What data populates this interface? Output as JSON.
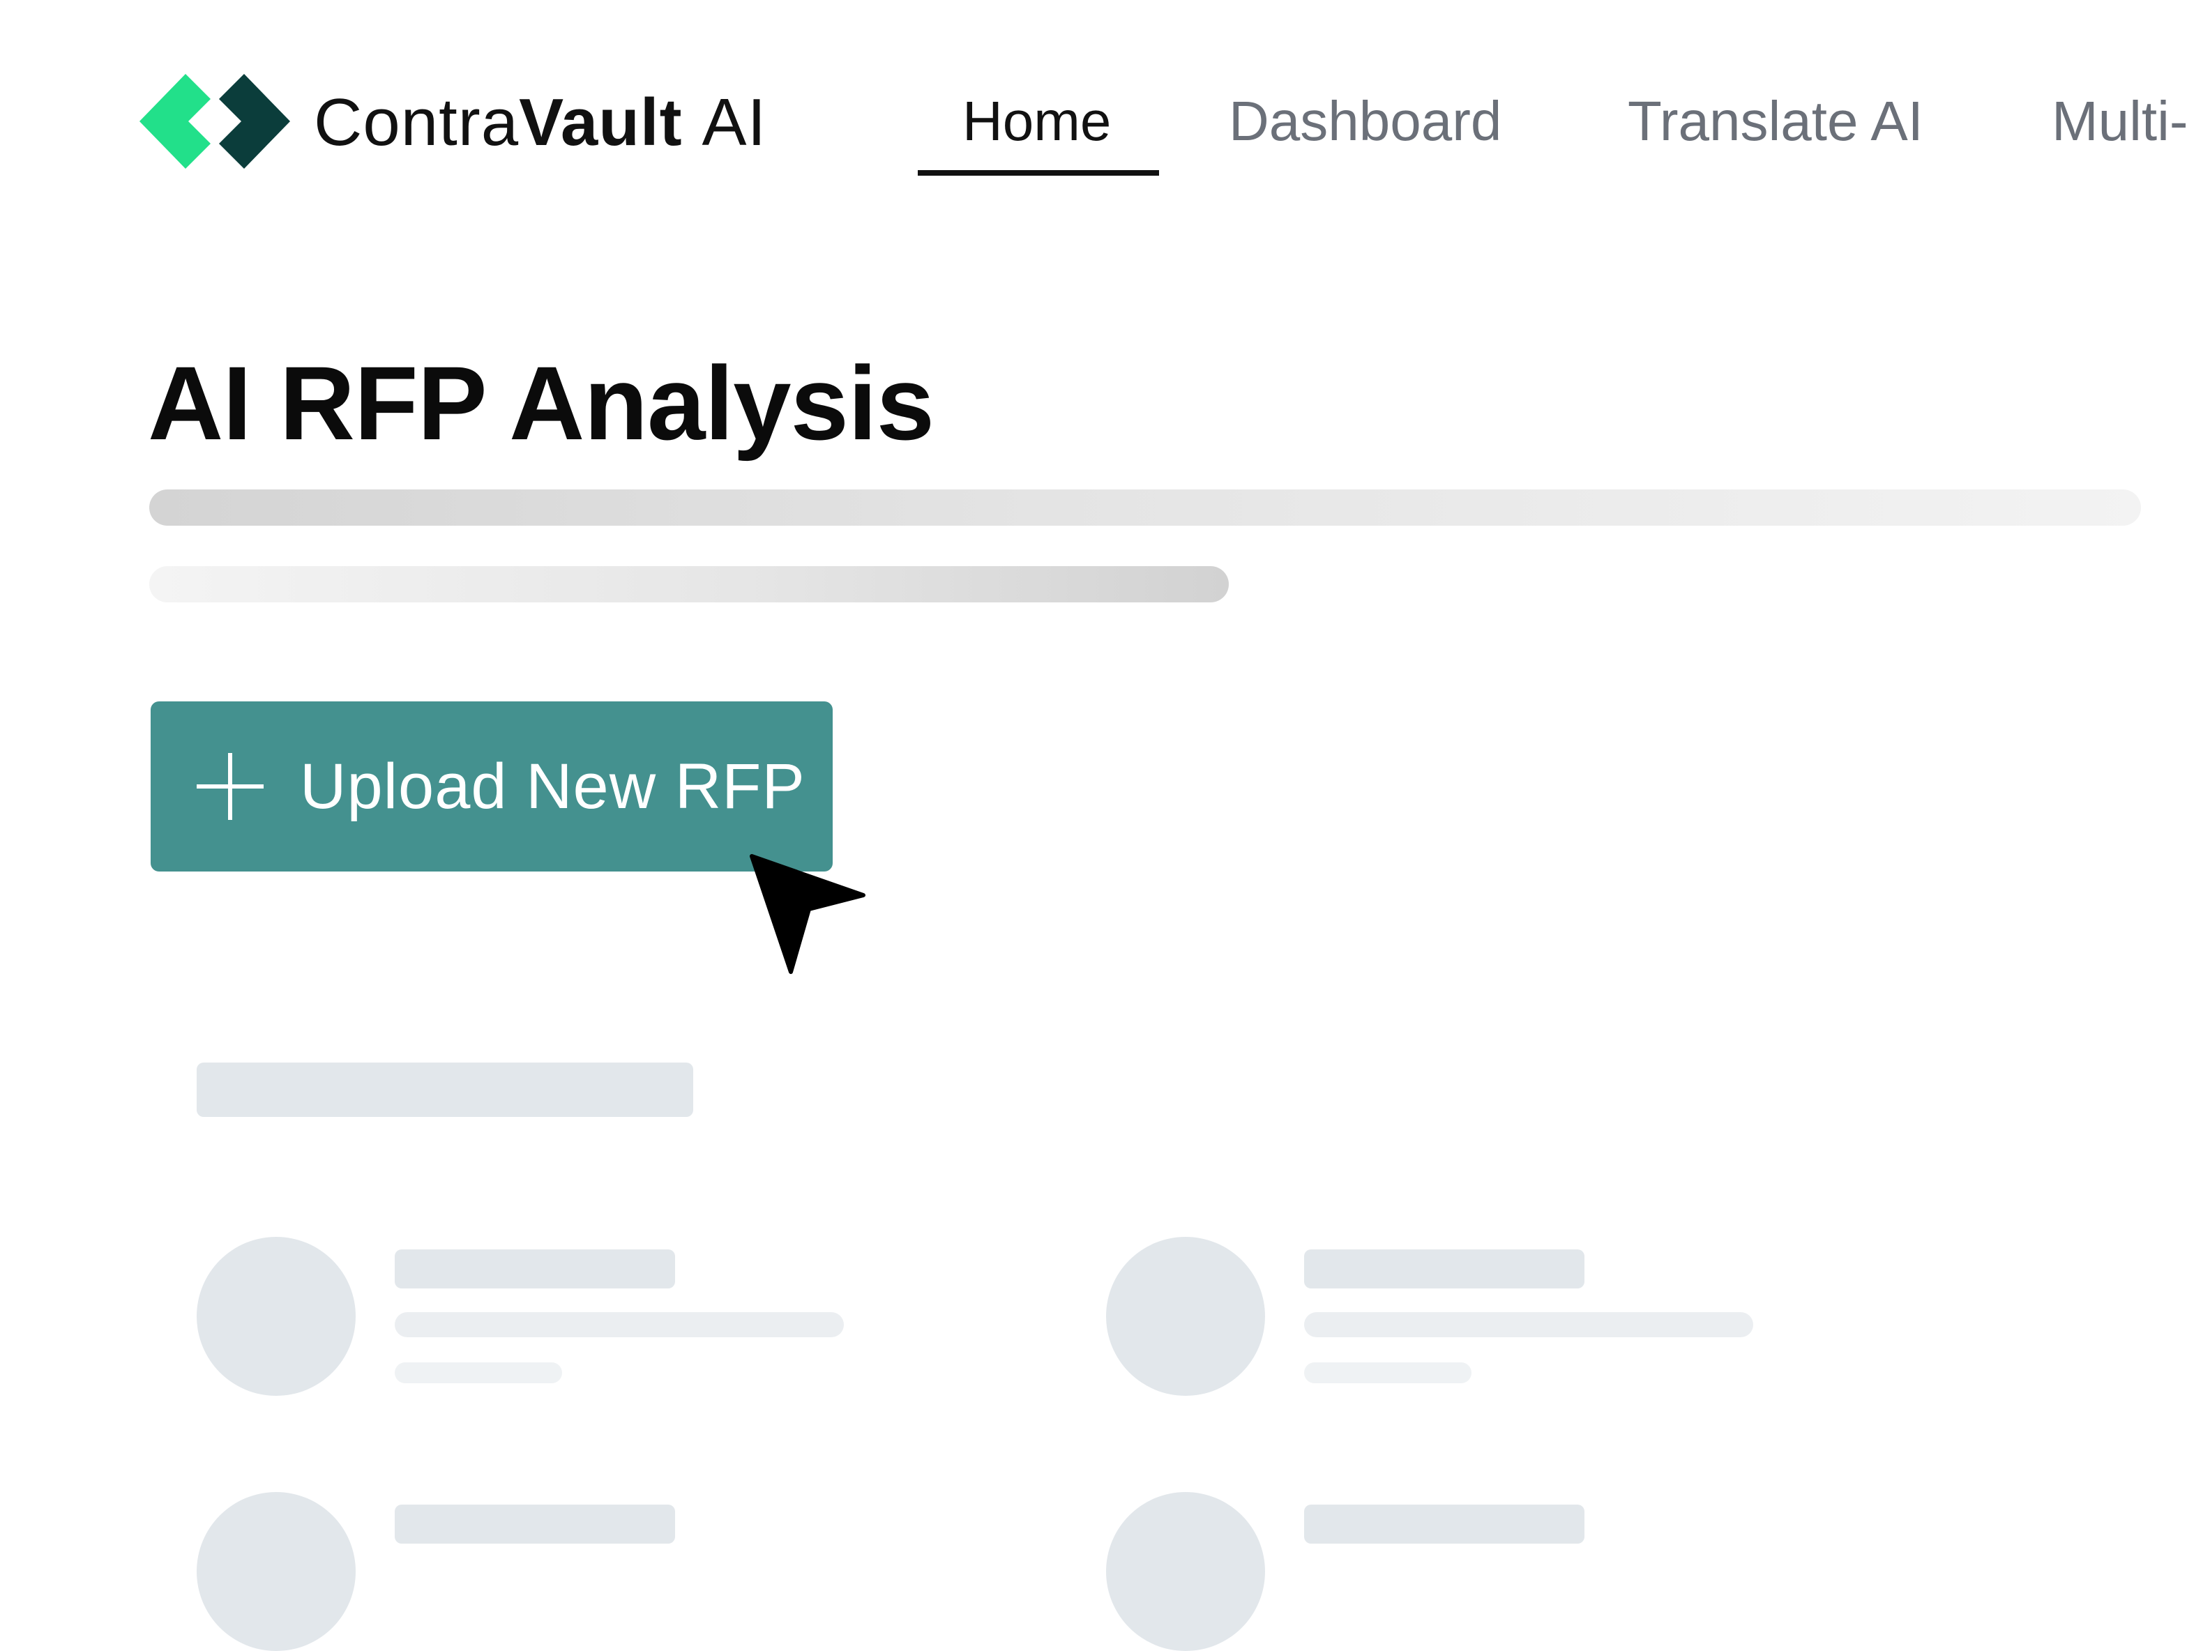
{
  "brand": {
    "name_light": "Contra",
    "name_bold": "Vault",
    "name_suffix": "AI",
    "logo_colors": [
      "#22e08a",
      "#0b3d3b"
    ]
  },
  "nav": {
    "items": [
      {
        "label": "Home",
        "active": true
      },
      {
        "label": "Dashboard",
        "active": false
      },
      {
        "label": "Translate AI",
        "active": false
      },
      {
        "label": "Multi-",
        "active": false
      }
    ]
  },
  "main": {
    "title": "AI RFP Analysis",
    "upload_button": {
      "label": "Upload New RFP",
      "icon": "plus-icon",
      "color": "#44918f"
    },
    "loading_state": true
  },
  "colors": {
    "accent": "#44918f",
    "skeleton": "#e2e7eb",
    "nav_inactive": "#6b7079"
  }
}
